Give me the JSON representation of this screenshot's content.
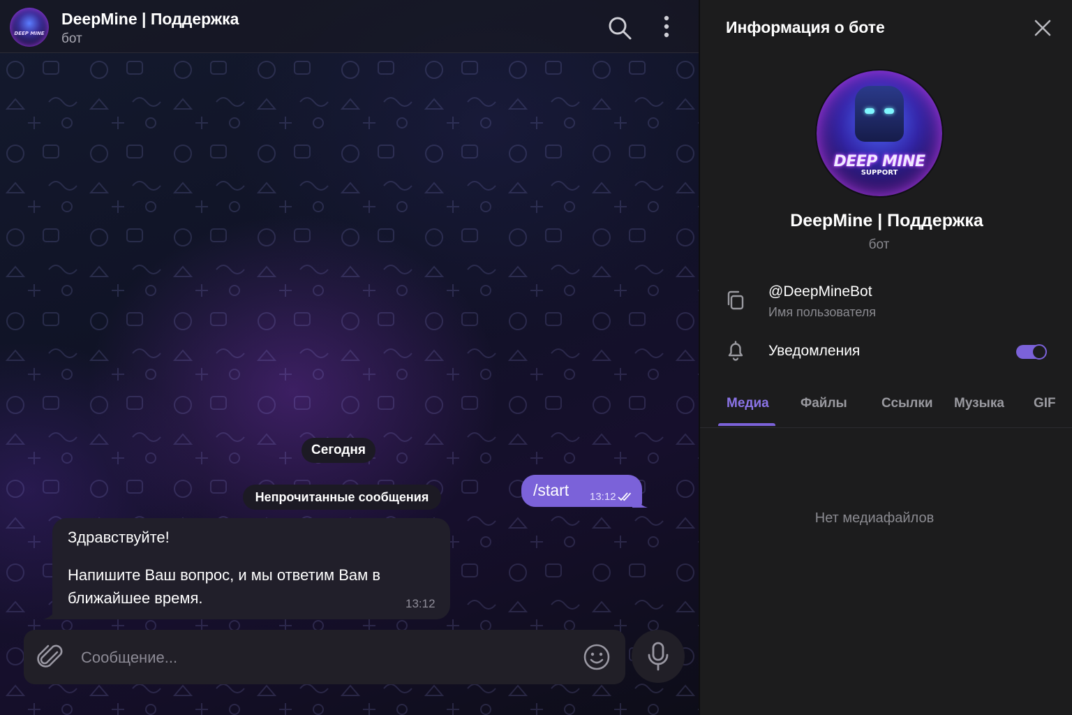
{
  "chat": {
    "title": "DeepMine | Поддержка",
    "subtitle": "бот",
    "avatar_logo": "DEEP MINE",
    "date_separator": "Сегодня",
    "unread_separator": "Непрочитанные сообщения",
    "outgoing": {
      "text": "/start",
      "time": "13:12",
      "status": "read"
    },
    "incoming": {
      "line1": "Здравствуйте!",
      "line2": "Напишите Ваш вопрос, и мы ответим Вам в",
      "line3": "ближайшее время.",
      "time": "13:12"
    },
    "composer_placeholder": "Сообщение..."
  },
  "info": {
    "title": "Информация о боте",
    "avatar_logo_main": "DEEP MINE",
    "avatar_logo_sub": "SUPPORT",
    "name": "DeepMine | Поддержка",
    "subtitle": "бот",
    "username": "@DeepMineBot",
    "username_label": "Имя пользователя",
    "notifications_label": "Уведомления",
    "notifications_on": true,
    "tabs": [
      "Медиа",
      "Файлы",
      "Ссылки",
      "Музыка",
      "GIF"
    ],
    "active_tab": "Медиа",
    "empty_text": "Нет медиафайлов"
  },
  "icons": {
    "search": "search-icon",
    "more": "more-vertical-icon",
    "attach": "paperclip-icon",
    "emoji": "smile-icon",
    "mic": "microphone-icon",
    "close": "close-icon",
    "copy": "copy-icon",
    "bell": "bell-icon"
  },
  "colors": {
    "accent": "#7b62d9",
    "bubble_out": "#7b62d9",
    "bubble_in": "#211f2a",
    "panel_bg": "#1c1c1d"
  }
}
